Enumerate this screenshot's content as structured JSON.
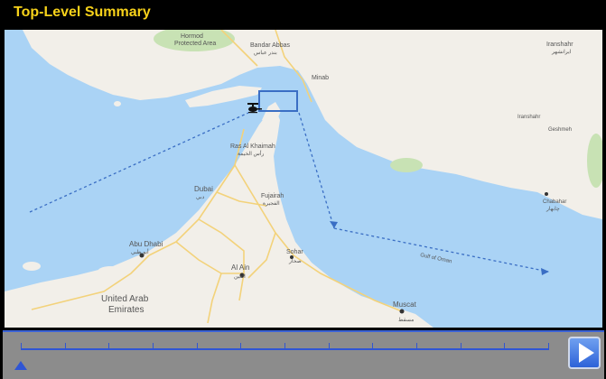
{
  "header": {
    "title": "Top-Level Summary"
  },
  "map": {
    "labels": {
      "hormod": "Hormod",
      "protected_area": "Protected Area",
      "bandar_abbas": "Bandar Abbas",
      "bandar_abbas_ar": "بندر عباس",
      "minab": "Minab",
      "iranshahr": "Iranshahr",
      "iranshahr_ar": "ایرانشهر",
      "ras_al_khaimah": "Ras Al Khaimah",
      "ras_al_khaimah_ar": "رأس الخيمة",
      "dubai": "Dubai",
      "dubai_ar": "دبي",
      "fujairah": "Fujairah",
      "fujairah_ar": "الفجيرة",
      "abu_dhabi": "Abu Dhabi",
      "abu_dhabi_ar": "أبو ظبي",
      "al_ain": "Al Ain",
      "al_ain_ar": "العين",
      "sohar": "Sohar",
      "sohar_ar": "صحار",
      "gulf_of_oman": "Gulf of Oman",
      "uae_line1": "United Arab",
      "uae_line2": "Emirates",
      "muscat": "Muscat",
      "muscat_ar": "مسقط",
      "chabahar": "Chabahar",
      "chabahar_ar": "چابهار",
      "iranshahr2": "Iranshahr",
      "geshmeh": "Geshmeh"
    },
    "colors": {
      "land": "#f2efe9",
      "water": "#aad3f5",
      "park": "#c8e2b4",
      "route": "#3a6ec4",
      "road": "#f3d27a"
    }
  },
  "timeline": {
    "ticks": 13,
    "playhead_fraction": 0.0,
    "play_icon": "play-icon"
  }
}
